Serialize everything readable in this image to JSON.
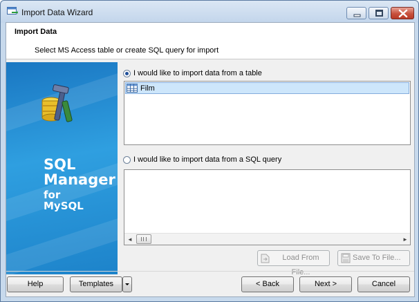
{
  "window": {
    "title": "Import Data Wizard"
  },
  "header": {
    "title": "Import Data",
    "subtitle": "Select MS Access table or create SQL query for import"
  },
  "banner": {
    "line1": "SQL",
    "line2": "Manager",
    "line3": "for",
    "line4": "MySQL"
  },
  "source": {
    "table_option_label": "I would like to import data from a table",
    "table_option_selected": true,
    "tables": [
      {
        "name": "Film",
        "selected": true
      }
    ],
    "query_option_label": "I would like to import data from a SQL query",
    "query_option_selected": false,
    "query_text": ""
  },
  "query_buttons": {
    "load_label": "Load From File...",
    "save_label": "Save To File..."
  },
  "footer": {
    "help_label": "Help",
    "templates_label": "Templates",
    "back_label": "< Back",
    "next_label": "Next >",
    "cancel_label": "Cancel"
  },
  "colors": {
    "banner": "#2f9fe0",
    "selection": "#cde6fb",
    "close_button": "#c8513d"
  },
  "icons": {
    "app": "import-wizard-icon",
    "table": "table-icon",
    "load": "load-file-icon",
    "save": "save-disk-icon",
    "dropdown": "chevron-down-icon"
  }
}
